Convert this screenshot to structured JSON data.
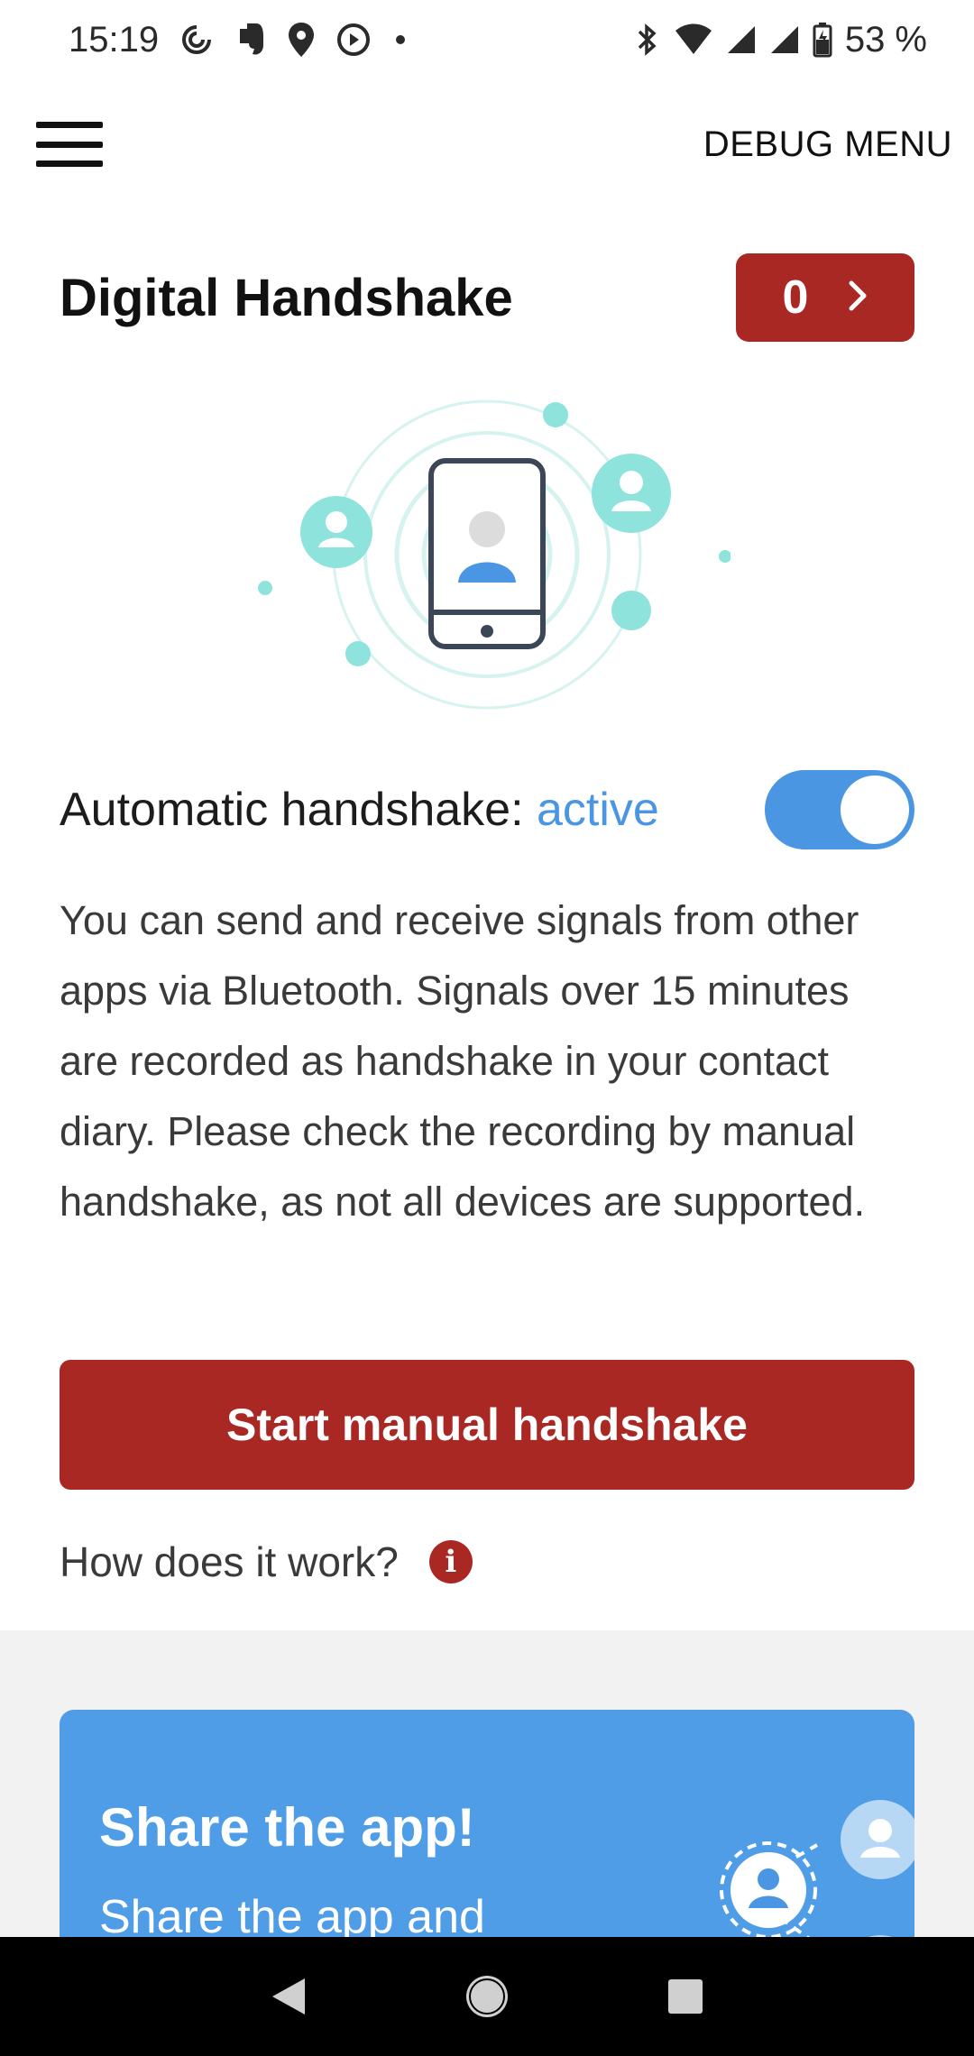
{
  "status_bar": {
    "time": "15:19",
    "battery": "53 %",
    "icons_left": [
      "sync-icon",
      "evernote-icon",
      "location-icon",
      "media-icon",
      "dot-icon"
    ],
    "icons_right": [
      "bluetooth-icon",
      "wifi-icon",
      "signal-icon",
      "signal-icon",
      "battery-icon"
    ]
  },
  "app_bar": {
    "menu_icon": "hamburger-menu-icon",
    "debug_menu_label": "DEBUG MENU"
  },
  "header": {
    "title": "Digital Handshake",
    "counter_value": "0",
    "counter_icon": "chevron-right-icon"
  },
  "colors": {
    "brand_red": "#a92824",
    "accent_blue": "#4a96e3",
    "card_blue": "#4f9de6",
    "teal": "#8ee3dc"
  },
  "toggle": {
    "label": "Automatic handshake:",
    "status": "active",
    "on": true
  },
  "description": "You can send and receive signals from other apps via Bluetooth. Signals over 15 minutes are recorded as handshake in your contact diary. Please check the recording by manual handshake, as not all devices are supported.",
  "manual_button_label": "Start manual handshake",
  "how_it_works": {
    "label": "How does it work?",
    "icon_glyph": "i"
  },
  "share_card": {
    "title": "Share the app!",
    "text": "Share the app and"
  },
  "nav_bar": {
    "items": [
      "back-icon",
      "home-icon",
      "recents-icon"
    ]
  }
}
